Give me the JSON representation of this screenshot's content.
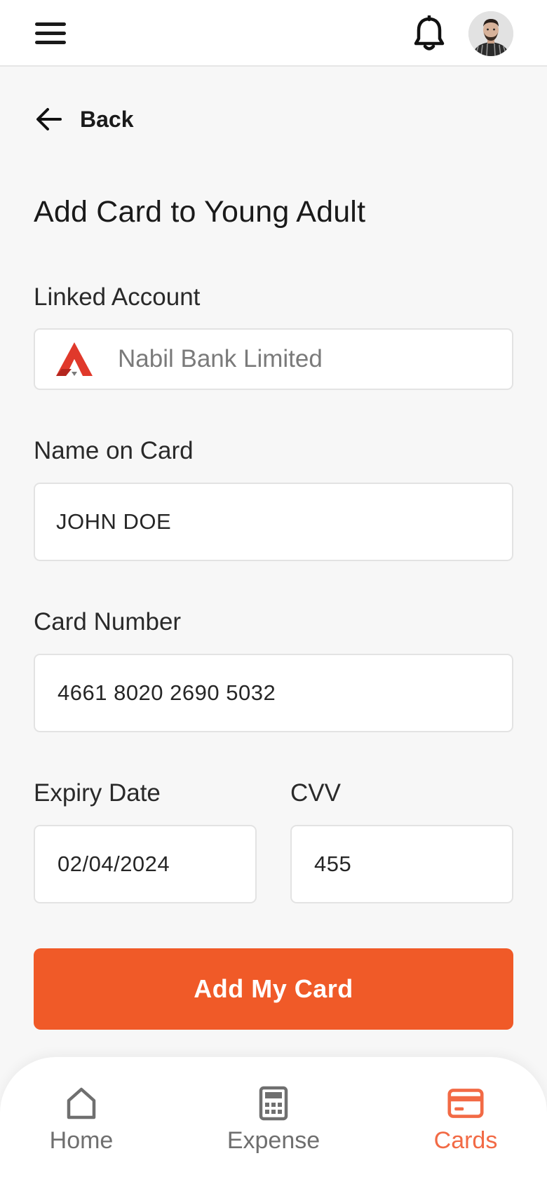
{
  "header": {
    "menu_icon": "hamburger-menu-icon",
    "notification_icon": "bell-icon",
    "avatar_icon": "user-avatar"
  },
  "back": {
    "label": "Back",
    "icon": "arrow-left-icon"
  },
  "page": {
    "title": "Add Card to Young Adult"
  },
  "form": {
    "linked_account": {
      "label": "Linked Account",
      "value": "Nabil Bank Limited",
      "icon": "nabil-bank-logo"
    },
    "name_on_card": {
      "label": "Name on Card",
      "value": "JOHN DOE"
    },
    "card_number": {
      "label": "Card Number",
      "value": "4661 8020 2690 5032"
    },
    "expiry_date": {
      "label": "Expiry Date",
      "value": "02/04/2024"
    },
    "cvv": {
      "label": "CVV",
      "value": "455"
    },
    "submit_label": "Add My Card"
  },
  "bottom_nav": {
    "items": [
      {
        "label": "Home",
        "icon": "home-icon",
        "active": false
      },
      {
        "label": "Expense",
        "icon": "calculator-icon",
        "active": false
      },
      {
        "label": "Cards",
        "icon": "credit-card-icon",
        "active": true
      }
    ]
  },
  "colors": {
    "accent": "#f05a28",
    "active_nav": "#f26a45",
    "bank_logo_red": "#e0392b"
  }
}
